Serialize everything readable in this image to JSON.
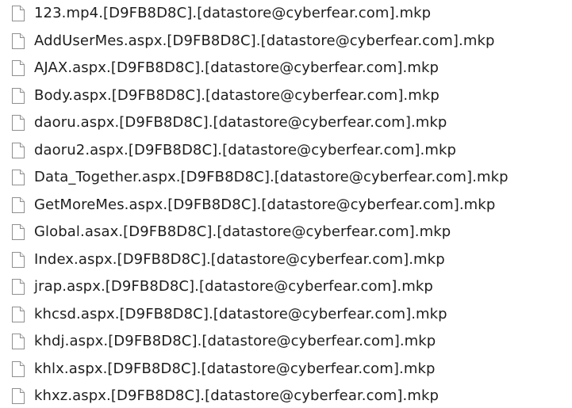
{
  "file_icon": "blank-document-icon",
  "files": [
    {
      "name": "123.mp4.[D9FB8D8C].[datastore@cyberfear.com].mkp"
    },
    {
      "name": "AddUserMes.aspx.[D9FB8D8C].[datastore@cyberfear.com].mkp"
    },
    {
      "name": "AJAX.aspx.[D9FB8D8C].[datastore@cyberfear.com].mkp"
    },
    {
      "name": "Body.aspx.[D9FB8D8C].[datastore@cyberfear.com].mkp"
    },
    {
      "name": "daoru.aspx.[D9FB8D8C].[datastore@cyberfear.com].mkp"
    },
    {
      "name": "daoru2.aspx.[D9FB8D8C].[datastore@cyberfear.com].mkp"
    },
    {
      "name": "Data_Together.aspx.[D9FB8D8C].[datastore@cyberfear.com].mkp"
    },
    {
      "name": "GetMoreMes.aspx.[D9FB8D8C].[datastore@cyberfear.com].mkp"
    },
    {
      "name": "Global.asax.[D9FB8D8C].[datastore@cyberfear.com].mkp"
    },
    {
      "name": "Index.aspx.[D9FB8D8C].[datastore@cyberfear.com].mkp"
    },
    {
      "name": "jrap.aspx.[D9FB8D8C].[datastore@cyberfear.com].mkp"
    },
    {
      "name": "khcsd.aspx.[D9FB8D8C].[datastore@cyberfear.com].mkp"
    },
    {
      "name": "khdj.aspx.[D9FB8D8C].[datastore@cyberfear.com].mkp"
    },
    {
      "name": "khlx.aspx.[D9FB8D8C].[datastore@cyberfear.com].mkp"
    },
    {
      "name": "khxz.aspx.[D9FB8D8C].[datastore@cyberfear.com].mkp"
    }
  ]
}
